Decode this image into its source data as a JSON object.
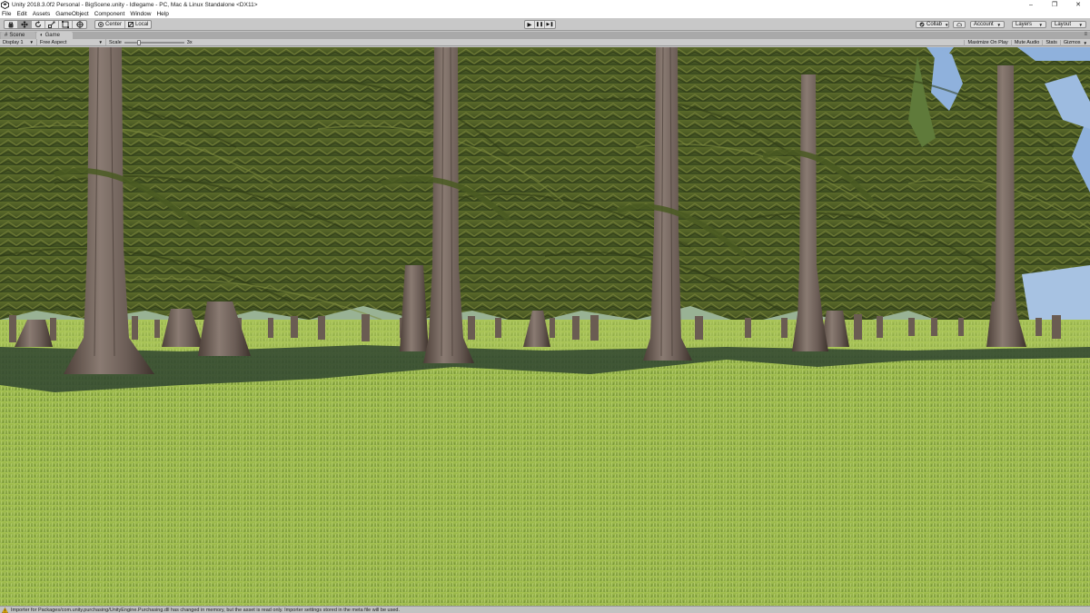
{
  "window": {
    "title": "Unity 2018.3.0f2 Personal - BigScene.unity - Idlegame - PC, Mac & Linux Standalone <DX11>",
    "minimize": "–",
    "maximize": "❐",
    "close": "✕"
  },
  "menu": {
    "items": [
      "File",
      "Edit",
      "Assets",
      "GameObject",
      "Component",
      "Window",
      "Help"
    ]
  },
  "toolbar": {
    "tools": [
      "hand-tool",
      "move-tool",
      "rotate-tool",
      "scale-tool",
      "rect-tool",
      "transform-tool"
    ],
    "pivot_label": "Center",
    "space_label": "Local",
    "play": "▶",
    "pause": "❚❚",
    "step": "▶❚",
    "collab_label": "Collab",
    "account_label": "Account",
    "layers_label": "Layers",
    "layout_label": "Layout"
  },
  "tabs": [
    {
      "label": "Scene",
      "icon": "scene-icon",
      "active": false
    },
    {
      "label": "Game",
      "icon": "game-icon",
      "active": true
    }
  ],
  "tab_menu": "≡",
  "game_bar": {
    "display": "Display 1",
    "aspect": "Free Aspect",
    "scale_label": "Scale",
    "scale_value": "3x",
    "maximize_on_play": "Maximize On Play",
    "mute_audio": "Mute Audio",
    "stats": "Stats",
    "gizmos": "Gizmos"
  },
  "status": {
    "message": "Importer for Packages/com.unity.purchasing/UnityEngine.Purchasing.dll has changed in memory, but the asset is read only. Importer settings stored in the meta file will be used."
  },
  "colors": {
    "sky": "#8fb1dc",
    "grass": "#8fae42",
    "foliage": "#4a5a22",
    "bark": "#6e5e55",
    "shadow": "#2f4430",
    "warning": "#f0b400"
  }
}
